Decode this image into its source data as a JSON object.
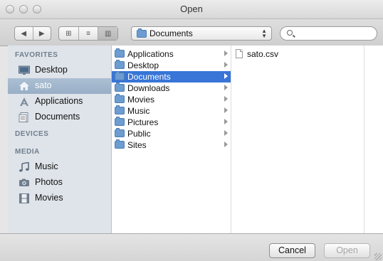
{
  "window": {
    "title": "Open"
  },
  "toolbar": {
    "back_glyph": "◀",
    "forward_glyph": "▶",
    "view_icons_glyph": "⊞",
    "view_list_glyph": "≡",
    "view_columns_glyph": "▥",
    "location": "Documents",
    "stepper_glyph_up": "▲",
    "stepper_glyph_down": "▼",
    "search_value": ""
  },
  "sidebar": {
    "sections": [
      {
        "label": "FAVORITES",
        "items": [
          {
            "label": "Desktop",
            "icon": "desktop-icon",
            "selected": false
          },
          {
            "label": "sato",
            "icon": "home-icon",
            "selected": true
          },
          {
            "label": "Applications",
            "icon": "applications-icon",
            "selected": false
          },
          {
            "label": "Documents",
            "icon": "documents-icon",
            "selected": false
          }
        ]
      },
      {
        "label": "DEVICES",
        "items": []
      },
      {
        "label": "MEDIA",
        "items": [
          {
            "label": "Music",
            "icon": "music-icon",
            "selected": false
          },
          {
            "label": "Photos",
            "icon": "camera-icon",
            "selected": false
          },
          {
            "label": "Movies",
            "icon": "film-icon",
            "selected": false
          }
        ]
      }
    ]
  },
  "browser": {
    "column1": [
      {
        "name": "Applications",
        "selected": false
      },
      {
        "name": "Desktop",
        "selected": false
      },
      {
        "name": "Documents",
        "selected": true
      },
      {
        "name": "Downloads",
        "selected": false
      },
      {
        "name": "Movies",
        "selected": false
      },
      {
        "name": "Music",
        "selected": false
      },
      {
        "name": "Pictures",
        "selected": false
      },
      {
        "name": "Public",
        "selected": false
      },
      {
        "name": "Sites",
        "selected": false
      }
    ],
    "column2": [
      {
        "name": "sato.csv"
      }
    ]
  },
  "buttons": {
    "cancel": "Cancel",
    "open": "Open"
  },
  "colors": {
    "selection": "#3875d7",
    "sidebar_bg": "#dfe4ea",
    "sidebar_selection": "#a3b8cd"
  }
}
